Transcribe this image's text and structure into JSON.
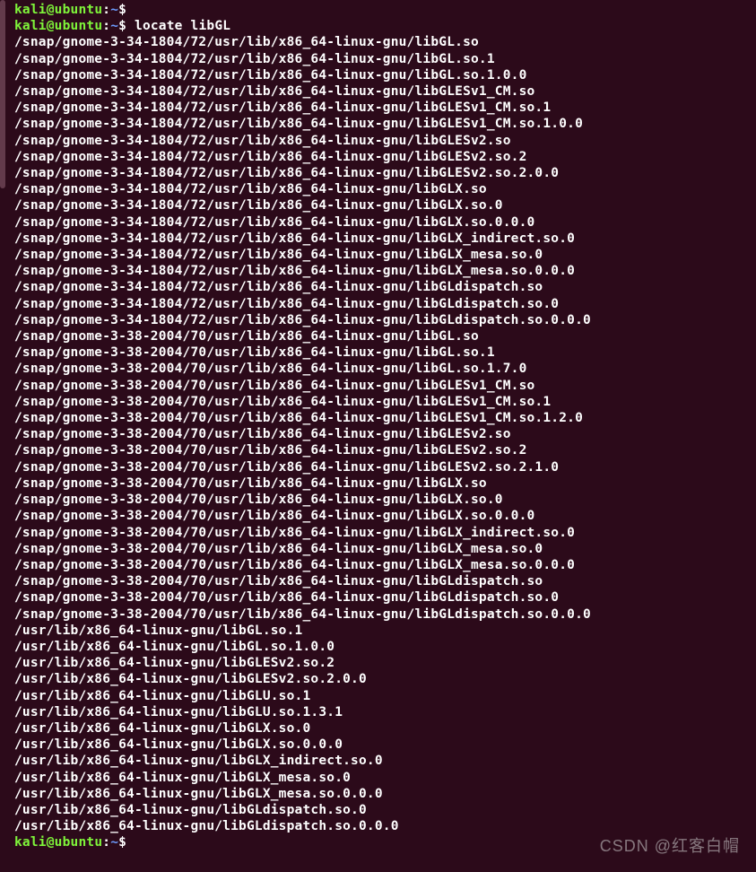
{
  "prompt": {
    "user": "kali",
    "host": "ubuntu",
    "path": "~",
    "symbol": "$"
  },
  "commands": [
    "",
    "locate libGL"
  ],
  "output": [
    "/snap/gnome-3-34-1804/72/usr/lib/x86_64-linux-gnu/libGL.so",
    "/snap/gnome-3-34-1804/72/usr/lib/x86_64-linux-gnu/libGL.so.1",
    "/snap/gnome-3-34-1804/72/usr/lib/x86_64-linux-gnu/libGL.so.1.0.0",
    "/snap/gnome-3-34-1804/72/usr/lib/x86_64-linux-gnu/libGLESv1_CM.so",
    "/snap/gnome-3-34-1804/72/usr/lib/x86_64-linux-gnu/libGLESv1_CM.so.1",
    "/snap/gnome-3-34-1804/72/usr/lib/x86_64-linux-gnu/libGLESv1_CM.so.1.0.0",
    "/snap/gnome-3-34-1804/72/usr/lib/x86_64-linux-gnu/libGLESv2.so",
    "/snap/gnome-3-34-1804/72/usr/lib/x86_64-linux-gnu/libGLESv2.so.2",
    "/snap/gnome-3-34-1804/72/usr/lib/x86_64-linux-gnu/libGLESv2.so.2.0.0",
    "/snap/gnome-3-34-1804/72/usr/lib/x86_64-linux-gnu/libGLX.so",
    "/snap/gnome-3-34-1804/72/usr/lib/x86_64-linux-gnu/libGLX.so.0",
    "/snap/gnome-3-34-1804/72/usr/lib/x86_64-linux-gnu/libGLX.so.0.0.0",
    "/snap/gnome-3-34-1804/72/usr/lib/x86_64-linux-gnu/libGLX_indirect.so.0",
    "/snap/gnome-3-34-1804/72/usr/lib/x86_64-linux-gnu/libGLX_mesa.so.0",
    "/snap/gnome-3-34-1804/72/usr/lib/x86_64-linux-gnu/libGLX_mesa.so.0.0.0",
    "/snap/gnome-3-34-1804/72/usr/lib/x86_64-linux-gnu/libGLdispatch.so",
    "/snap/gnome-3-34-1804/72/usr/lib/x86_64-linux-gnu/libGLdispatch.so.0",
    "/snap/gnome-3-34-1804/72/usr/lib/x86_64-linux-gnu/libGLdispatch.so.0.0.0",
    "/snap/gnome-3-38-2004/70/usr/lib/x86_64-linux-gnu/libGL.so",
    "/snap/gnome-3-38-2004/70/usr/lib/x86_64-linux-gnu/libGL.so.1",
    "/snap/gnome-3-38-2004/70/usr/lib/x86_64-linux-gnu/libGL.so.1.7.0",
    "/snap/gnome-3-38-2004/70/usr/lib/x86_64-linux-gnu/libGLESv1_CM.so",
    "/snap/gnome-3-38-2004/70/usr/lib/x86_64-linux-gnu/libGLESv1_CM.so.1",
    "/snap/gnome-3-38-2004/70/usr/lib/x86_64-linux-gnu/libGLESv1_CM.so.1.2.0",
    "/snap/gnome-3-38-2004/70/usr/lib/x86_64-linux-gnu/libGLESv2.so",
    "/snap/gnome-3-38-2004/70/usr/lib/x86_64-linux-gnu/libGLESv2.so.2",
    "/snap/gnome-3-38-2004/70/usr/lib/x86_64-linux-gnu/libGLESv2.so.2.1.0",
    "/snap/gnome-3-38-2004/70/usr/lib/x86_64-linux-gnu/libGLX.so",
    "/snap/gnome-3-38-2004/70/usr/lib/x86_64-linux-gnu/libGLX.so.0",
    "/snap/gnome-3-38-2004/70/usr/lib/x86_64-linux-gnu/libGLX.so.0.0.0",
    "/snap/gnome-3-38-2004/70/usr/lib/x86_64-linux-gnu/libGLX_indirect.so.0",
    "/snap/gnome-3-38-2004/70/usr/lib/x86_64-linux-gnu/libGLX_mesa.so.0",
    "/snap/gnome-3-38-2004/70/usr/lib/x86_64-linux-gnu/libGLX_mesa.so.0.0.0",
    "/snap/gnome-3-38-2004/70/usr/lib/x86_64-linux-gnu/libGLdispatch.so",
    "/snap/gnome-3-38-2004/70/usr/lib/x86_64-linux-gnu/libGLdispatch.so.0",
    "/snap/gnome-3-38-2004/70/usr/lib/x86_64-linux-gnu/libGLdispatch.so.0.0.0",
    "/usr/lib/x86_64-linux-gnu/libGL.so.1",
    "/usr/lib/x86_64-linux-gnu/libGL.so.1.0.0",
    "/usr/lib/x86_64-linux-gnu/libGLESv2.so.2",
    "/usr/lib/x86_64-linux-gnu/libGLESv2.so.2.0.0",
    "/usr/lib/x86_64-linux-gnu/libGLU.so.1",
    "/usr/lib/x86_64-linux-gnu/libGLU.so.1.3.1",
    "/usr/lib/x86_64-linux-gnu/libGLX.so.0",
    "/usr/lib/x86_64-linux-gnu/libGLX.so.0.0.0",
    "/usr/lib/x86_64-linux-gnu/libGLX_indirect.so.0",
    "/usr/lib/x86_64-linux-gnu/libGLX_mesa.so.0",
    "/usr/lib/x86_64-linux-gnu/libGLX_mesa.so.0.0.0",
    "/usr/lib/x86_64-linux-gnu/libGLdispatch.so.0",
    "/usr/lib/x86_64-linux-gnu/libGLdispatch.so.0.0.0"
  ],
  "trailing_prompt": true,
  "watermark": "CSDN @红客白帽"
}
